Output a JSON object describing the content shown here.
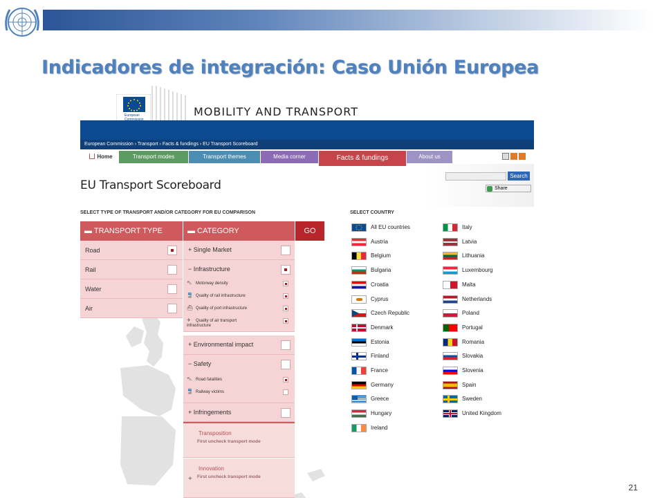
{
  "slide": {
    "title": "Indicadores de integración: Caso Unión Europea",
    "page_number": "21"
  },
  "header": {
    "site_title": "MOBILITY AND TRANSPORT",
    "logo_text": "European Commission",
    "breadcrumb": "European Commission › Transport › Facts & fundings › EU Transport Scoreboard"
  },
  "nav": {
    "home": "Home",
    "transport_modes": "Transport modes",
    "transport_themes": "Transport themes",
    "media_corner": "Media corner",
    "facts_fundings": "Facts & fundings",
    "about_us": "About us"
  },
  "page": {
    "title": "EU Transport Scoreboard",
    "search_button": "Search",
    "share_label": "Share",
    "select_type_label": "SELECT TYPE OF TRANSPORT AND/OR CATEGORY FOR EU COMPARISON",
    "select_country_label": "SELECT COUNTRY"
  },
  "transport_type": {
    "header": "▬ TRANSPORT TYPE",
    "rows": [
      {
        "label": "Road",
        "checked": true
      },
      {
        "label": "Rail",
        "checked": false
      },
      {
        "label": "Water",
        "checked": false
      },
      {
        "label": "Air",
        "checked": false
      }
    ]
  },
  "category": {
    "header": "▬ CATEGORY",
    "go_label": "GO",
    "single_market": "+  Single Market",
    "infrastructure": "−  Infrastructure",
    "infra_items": [
      {
        "label": "Motorway density",
        "icon": "car-icon"
      },
      {
        "label": "Quality of rail infrastructure",
        "icon": "train-icon"
      },
      {
        "label": "Quality of port infrastructure",
        "icon": "ship-icon"
      },
      {
        "label": "Quality of air transport infrastructure",
        "icon": "plane-icon"
      }
    ],
    "environmental": "+  Environmental impact",
    "safety": "−  Safety",
    "safety_items": [
      {
        "label": "Road fatalities",
        "icon": "car-icon"
      },
      {
        "label": "Railway victims",
        "icon": "train-icon"
      }
    ],
    "infringements": "+  Infringements",
    "transposition": "Transposition",
    "transposition_note": "First uncheck transport mode",
    "innovation": "Innovation",
    "innovation_plus": "+",
    "innovation_note": "First uncheck transport mode"
  },
  "countries_left": [
    {
      "name": "All EU countries",
      "flag": "eu"
    },
    {
      "name": "Austria",
      "flag": "at"
    },
    {
      "name": "Belgium",
      "flag": "be"
    },
    {
      "name": "Bulgaria",
      "flag": "bg"
    },
    {
      "name": "Croatia",
      "flag": "hr"
    },
    {
      "name": "Cyprus",
      "flag": "cy"
    },
    {
      "name": "Czech Republic",
      "flag": "cz"
    },
    {
      "name": "Denmark",
      "flag": "dk"
    },
    {
      "name": "Estonia",
      "flag": "ee"
    },
    {
      "name": "Finland",
      "flag": "fi"
    },
    {
      "name": "France",
      "flag": "fr"
    },
    {
      "name": "Germany",
      "flag": "de"
    },
    {
      "name": "Greece",
      "flag": "gr"
    },
    {
      "name": "Hungary",
      "flag": "hu"
    },
    {
      "name": "Ireland",
      "flag": "ie"
    }
  ],
  "countries_right": [
    {
      "name": "Italy",
      "flag": "it"
    },
    {
      "name": "Latvia",
      "flag": "lv"
    },
    {
      "name": "Lithuania",
      "flag": "lt"
    },
    {
      "name": "Luxembourg",
      "flag": "lu"
    },
    {
      "name": "Malta",
      "flag": "mt"
    },
    {
      "name": "Netherlands",
      "flag": "nl"
    },
    {
      "name": "Poland",
      "flag": "pl"
    },
    {
      "name": "Portugal",
      "flag": "pt"
    },
    {
      "name": "Romania",
      "flag": "ro"
    },
    {
      "name": "Slovakia",
      "flag": "sk"
    },
    {
      "name": "Slovenia",
      "flag": "si"
    },
    {
      "name": "Spain",
      "flag": "es"
    },
    {
      "name": "Sweden",
      "flag": "se"
    },
    {
      "name": "United Kingdom",
      "flag": "gb"
    }
  ]
}
